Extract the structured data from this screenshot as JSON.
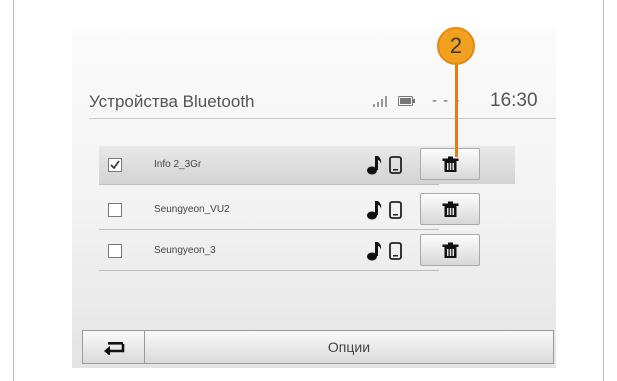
{
  "header": {
    "title": "Устройства Bluetooth",
    "status_dashes": "- - -",
    "time": "16:30",
    "icons": [
      "signal-icon",
      "battery-icon"
    ]
  },
  "devices": [
    {
      "name": "Info 2_3Gr",
      "checked": true,
      "selected": true,
      "icons": [
        "music-icon",
        "phone-icon",
        "trash-icon"
      ]
    },
    {
      "name": "Seungyeon_VU2",
      "checked": false,
      "selected": false,
      "icons": [
        "music-icon",
        "phone-icon",
        "trash-icon"
      ]
    },
    {
      "name": "Seungyeon_3",
      "checked": false,
      "selected": false,
      "icons": [
        "music-icon",
        "phone-icon",
        "trash-icon"
      ]
    }
  ],
  "bottom_bar": {
    "back_icon": "back-arrow-icon",
    "options_label": "Опции"
  },
  "callout": {
    "number": "2",
    "color": "#f2a01f"
  }
}
